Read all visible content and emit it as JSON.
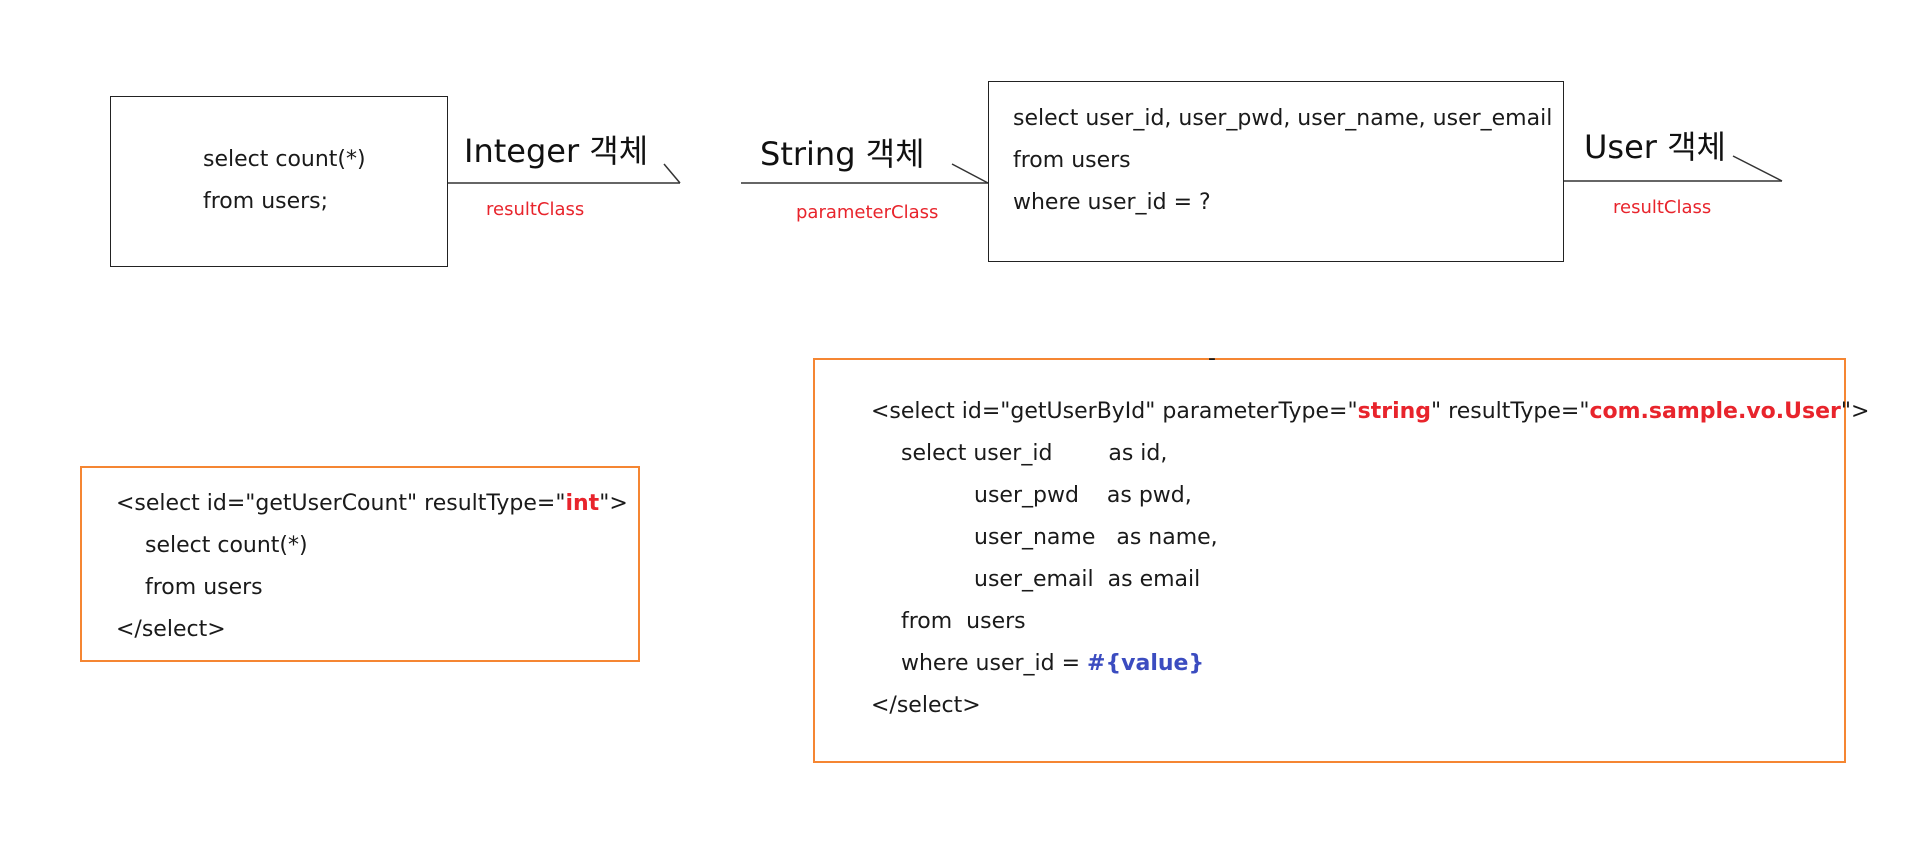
{
  "diagram": {
    "count_query_box": {
      "lines": [
        "select count(*)",
        "from users;"
      ]
    },
    "integer_arrow": {
      "object_label": "Integer 객체",
      "relation_label": "resultClass"
    },
    "string_arrow": {
      "object_label": "String 객체",
      "relation_label": "parameterClass"
    },
    "user_query_box": {
      "lines": [
        "select user_id, user_pwd, user_name, user_email",
        "from users",
        "where user_id = ?"
      ]
    },
    "user_arrow": {
      "object_label": "User 객체",
      "relation_label": "resultClass"
    }
  },
  "mapper_count": {
    "line1_prefix": "<select id=\"getUserCount\" resultType=\"",
    "line1_type": "int",
    "line1_suffix": "\">",
    "line2": "select count(*)",
    "line3": "from users",
    "line4": "</select>"
  },
  "mapper_user": {
    "dash": "-",
    "line1_prefix": "<select id=\"getUserById\" parameterType=\"",
    "line1_param_type": "string",
    "line1_mid": "\" resultType=\"",
    "line1_result_type": "com.sample.vo.User",
    "line1_suffix": "\">",
    "line2": "select user_id        as id,",
    "line3": "user_pwd    as pwd,",
    "line4": "user_name   as name,",
    "line5": "user_email  as email",
    "line6": "from  users",
    "line7_prefix": "where user_id = ",
    "line7_value": "#{value}",
    "line8": "</select>"
  },
  "colors": {
    "accent_red": "#e8242c",
    "accent_blue": "#3b4cc0",
    "box_orange": "#f58632"
  }
}
